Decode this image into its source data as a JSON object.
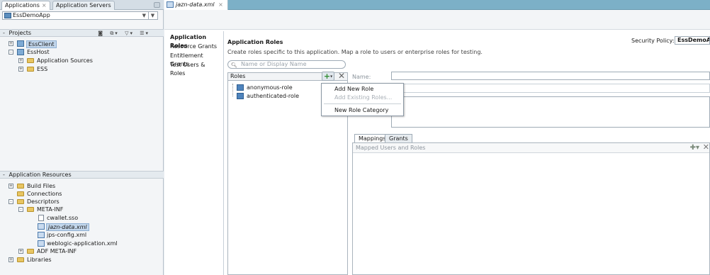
{
  "left_tabs": {
    "applications": "Applications",
    "app_servers": "Application Servers",
    "close_glyph": "×"
  },
  "app_selector": {
    "value": "EssDemoApp"
  },
  "projects": {
    "header": "Projects",
    "items": [
      {
        "label": "EssClient",
        "selected": true
      },
      {
        "label": "EssHost"
      },
      {
        "label": "Application Sources"
      },
      {
        "label": "ESS"
      }
    ]
  },
  "app_resources": {
    "header": "Application Resources",
    "items": [
      {
        "label": "Build Files"
      },
      {
        "label": "Connections"
      },
      {
        "label": "Descriptors"
      },
      {
        "label": "META-INF"
      },
      {
        "label": "cwallet.sso"
      },
      {
        "label": "jazn-data.xml",
        "selected": true
      },
      {
        "label": "jps-config.xml"
      },
      {
        "label": "weblogic-application.xml"
      },
      {
        "label": "ADF META-INF"
      },
      {
        "label": "Libraries"
      }
    ]
  },
  "editor_tab": {
    "label": "jazn-data.xml",
    "close_glyph": "×"
  },
  "nav": {
    "items": [
      {
        "label": "Application Roles",
        "active": true
      },
      {
        "label": "Resource Grants"
      },
      {
        "label": "Entitlement Grants"
      },
      {
        "label": "Test Users & Roles"
      }
    ]
  },
  "content": {
    "title": "Application Roles",
    "description": "Create roles specific to this application. Map a role to users or enterprise roles for testing.",
    "security_policy_label": "Security Policy:",
    "security_policy_value": "EssDemoApp",
    "search_placeholder": "Name or Display Name",
    "roles_header": "Roles",
    "roles": [
      {
        "label": "anonymous-role"
      },
      {
        "label": "authenticated-role"
      }
    ],
    "name_label": "Name:"
  },
  "popup_menu": {
    "items": [
      {
        "label": "Add New Role",
        "disabled": false
      },
      {
        "label": "Add Existing Roles...",
        "disabled": true
      },
      {
        "label": "New Role Category",
        "disabled": false
      }
    ]
  },
  "sub_tabs": [
    {
      "label": "Mappings",
      "active": true
    },
    {
      "label": "Grants"
    }
  ],
  "mapped_panel": {
    "header": "Mapped Users and Roles"
  }
}
